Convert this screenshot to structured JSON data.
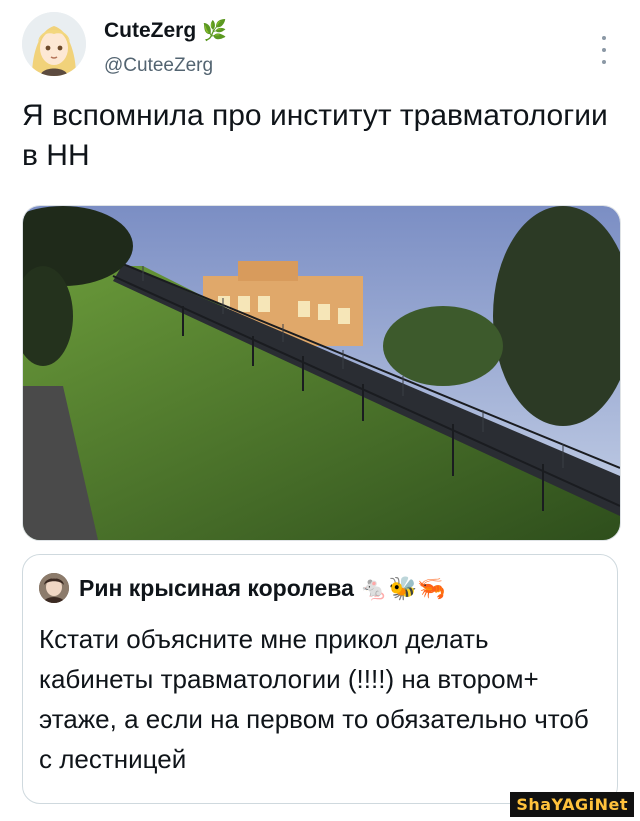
{
  "tweet": {
    "author_name": "CuteZerg",
    "handle": "@CuteeZerg",
    "name_emoji": "🌿",
    "text": "Я вспомнила про институт травматологии в НН"
  },
  "photo": {
    "description_icon": "photo-staircase-hill"
  },
  "quote": {
    "author_name": "Рин крысиная королева",
    "name_emojis": "🐁🐝🦐",
    "text": "Кстати объясните мне прикол делать кабинеты травматологии (!!!!) на втором+ этаже, а если на первом то обязательно чтоб с лестницей"
  },
  "watermark": {
    "text": "ShaYAGiNet"
  },
  "colors": {
    "text": "#0f1419",
    "secondary": "#536471",
    "border": "#cfd9de",
    "watermark_bg": "#111111",
    "watermark_fg": "#ffc23c"
  }
}
